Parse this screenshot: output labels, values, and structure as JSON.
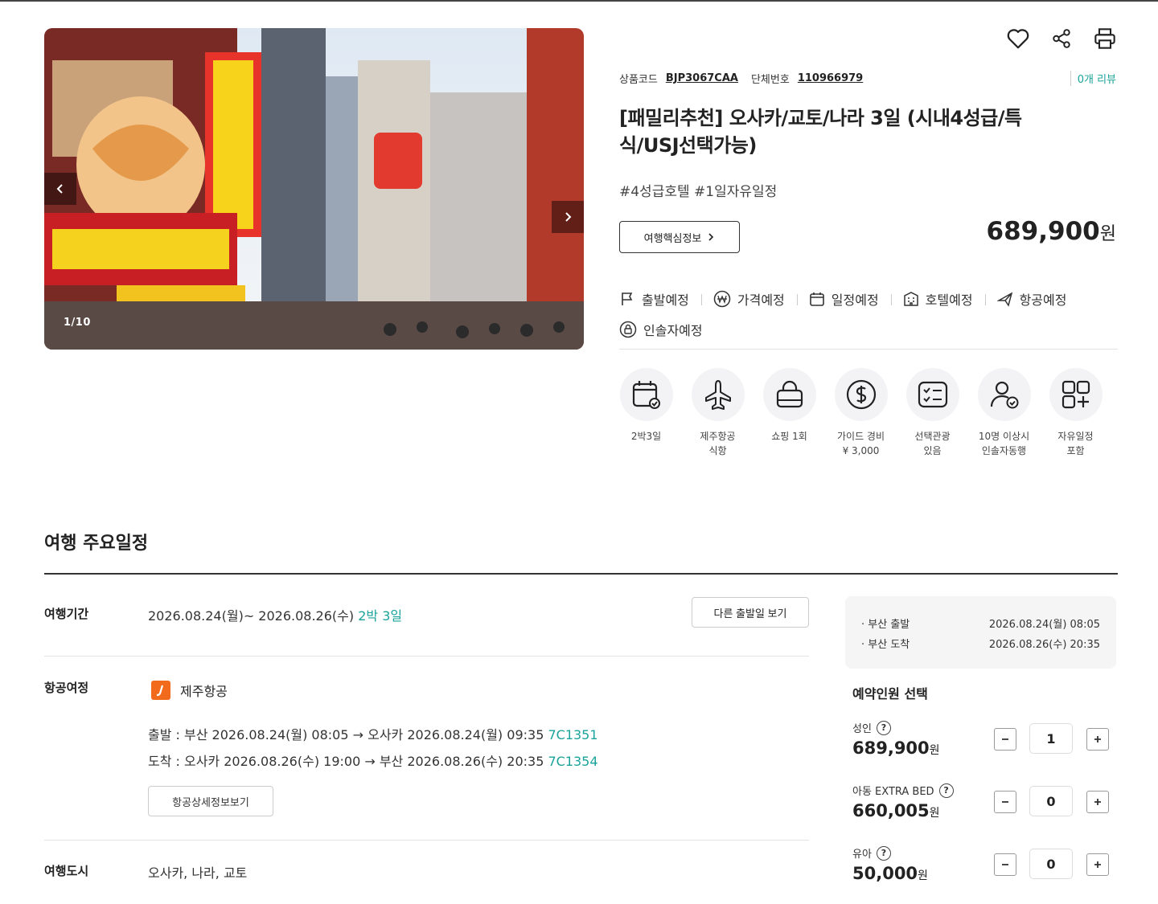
{
  "gallery": {
    "counter": "1/10",
    "image_alt": "Osaka Dotonbori street"
  },
  "actions": {
    "heart_icon": "heart-icon",
    "share_icon": "share-icon",
    "print_icon": "print-icon"
  },
  "product": {
    "code_label": "상품코드",
    "code_value": "BJP3067CAA",
    "group_label": "단체번호",
    "group_value": "110966979",
    "review": "0개 리뷰",
    "title": "[패밀리추천] 오사카/교토/나라 3일 (시내4성급/특식/USJ선택가능)",
    "tags": "#4성급호텔 #1일자유일정",
    "core_info_button": "여행핵심정보",
    "price": "689,900",
    "price_unit": "원"
  },
  "status": [
    {
      "icon": "flag-icon",
      "label": "출발예정"
    },
    {
      "icon": "won-icon",
      "label": "가격예정"
    },
    {
      "icon": "calendar-icon",
      "label": "일정예정"
    },
    {
      "icon": "building-icon",
      "label": "호텔예정"
    },
    {
      "icon": "plane-icon",
      "label": "항공예정"
    },
    {
      "icon": "lock-icon",
      "label": "인솔자예정"
    }
  ],
  "features": [
    {
      "icon": "calendar-check-icon",
      "label": "2박3일"
    },
    {
      "icon": "airplane-icon",
      "label": "제주항공\n식항"
    },
    {
      "icon": "shopping-bag-icon",
      "label": "쇼핑 1회"
    },
    {
      "icon": "dollar-icon",
      "label": "가이드 경비\n¥ 3,000"
    },
    {
      "icon": "checklist-icon",
      "label": "선택관광\n있음"
    },
    {
      "icon": "user-check-icon",
      "label": "10명 이상시\n인솔자동행"
    },
    {
      "icon": "grid-plus-icon",
      "label": "자유일정\n포함"
    }
  ],
  "schedule": {
    "section_title": "여행 주요일정",
    "period_label": "여행기간",
    "period_text": "2026.08.24(월)~ 2026.08.26(수)",
    "period_duration": "2박 3일",
    "other_dates_button": "다른 출발일 보기",
    "flight_label": "항공여정",
    "airline_name": "제주항공",
    "departure_text": "출발 : 부산 2026.08.24(월) 08:05 → 오사카 2026.08.24(월) 09:35",
    "departure_flight": "7C1351",
    "arrival_text": "도착 : 오사카 2026.08.26(수) 19:00 → 부산 2026.08.26(수) 20:35",
    "arrival_flight": "7C1354",
    "flight_detail_button": "항공상세정보보기",
    "city_label": "여행도시",
    "city_text": "오사카, 나라, 교토"
  },
  "booking": {
    "dep_label": "· 부산 출발",
    "dep_time": "2026.08.24(월) 08:05",
    "arr_label": "· 부산 도착",
    "arr_time": "2026.08.26(수) 20:35",
    "title": "예약인원 선택",
    "pax": [
      {
        "label": "성인",
        "price": "689,900",
        "unit": "원",
        "qty": "1"
      },
      {
        "label": "아동 EXTRA BED",
        "price": "660,005",
        "unit": "원",
        "qty": "0"
      },
      {
        "label": "유아",
        "price": "50,000",
        "unit": "원",
        "qty": "0"
      }
    ]
  },
  "colors": {
    "accent": "#1aa39a",
    "airline": "#f26b1d",
    "text": "#222222"
  }
}
